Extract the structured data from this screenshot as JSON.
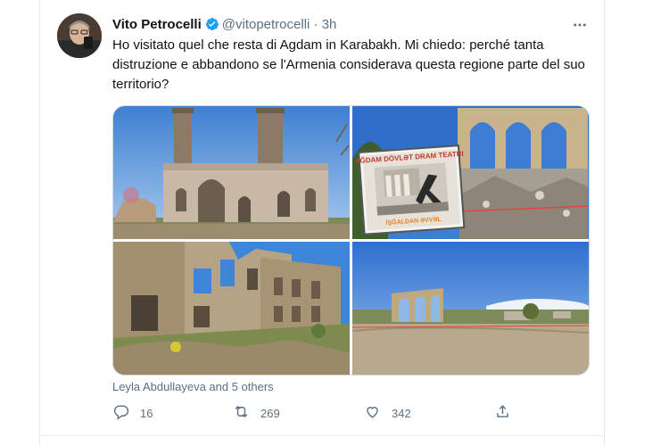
{
  "tweet": {
    "author_name": "Vito Petrocelli",
    "handle": "@vitopetrocelli",
    "separator": "·",
    "time": "3h",
    "text": "Ho visitato quel che resta di Agdam in Karabakh. Mi chiedo: perché tanta distruzione e abbandono se l'Armenia considerava questa regione parte del suo territorio?",
    "sign_text_1": "AĞDAM DÖVLƏT DRAM TEATRI",
    "sign_text_2": "İŞĞALDAN ƏVVƏL",
    "liked_by": "Leyla Abdullayeva and 5 others",
    "reply_count": "16",
    "retweet_count": "269",
    "like_count": "342"
  },
  "icons": {
    "verified": "verified-badge-icon",
    "more": "more-options-icon",
    "reply": "reply-icon",
    "retweet": "retweet-icon",
    "like": "heart-icon",
    "share": "share-icon"
  },
  "colors": {
    "verified": "#1da1f2",
    "secondary_text": "#5b7083",
    "primary_text": "#0f1419"
  }
}
